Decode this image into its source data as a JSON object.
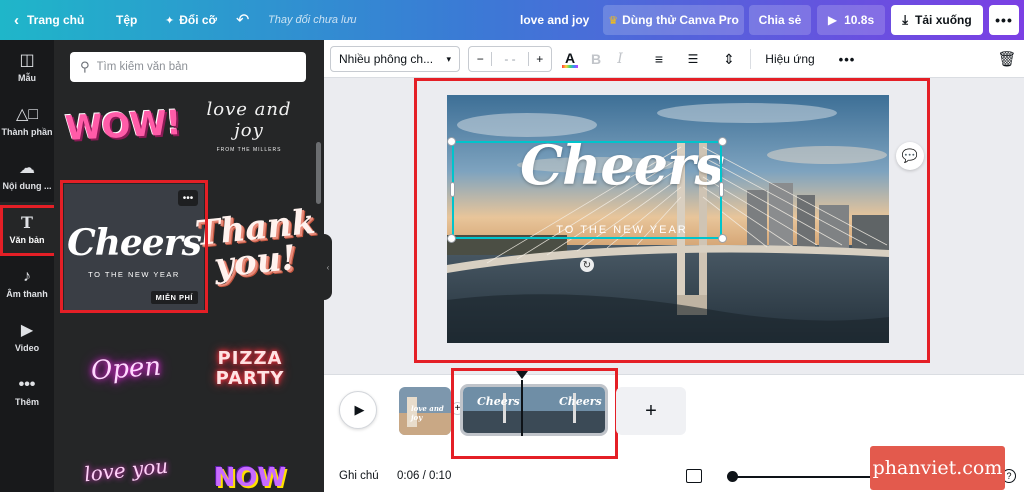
{
  "topbar": {
    "home": "Trang chủ",
    "file": "Tệp",
    "resize": "Đổi cỡ",
    "unsaved": "Thay đổi chưa lưu",
    "title": "love and joy",
    "try_pro": "Dùng thử Canva Pro",
    "share": "Chia sẻ",
    "duration": "10.8s",
    "download": "Tải xuống"
  },
  "rail": {
    "items": [
      {
        "label": "Mẫu",
        "icon": "template-icon"
      },
      {
        "label": "Thành phần",
        "icon": "elements-icon"
      },
      {
        "label": "Nội dung ...",
        "icon": "upload-icon"
      },
      {
        "label": "Văn bản",
        "icon": "text-icon"
      },
      {
        "label": "Âm thanh",
        "icon": "audio-icon"
      },
      {
        "label": "Video",
        "icon": "video-icon"
      },
      {
        "label": "Thêm",
        "icon": "more-icon"
      }
    ]
  },
  "panel": {
    "search_placeholder": "Tìm kiếm văn bản",
    "tiles": {
      "wow": "WOW!",
      "love_joy": "love and joy",
      "love_joy_sub": "FROM THE MILLERS",
      "cheers": "Cheers",
      "cheers_sub": "TO THE NEW YEAR",
      "free_badge": "MIỄN PHÍ",
      "thank_you_1": "Thank",
      "thank_you_2": "you!",
      "open": "Open",
      "pizza": "PIZZA",
      "party": "PARTY",
      "love2": "love you",
      "now": "NOW"
    }
  },
  "toolbar": {
    "font": "Nhiều phông ch...",
    "size": "- -",
    "effects": "Hiệu ứng"
  },
  "canvas": {
    "headline": "Cheers",
    "subline": "TO THE NEW YEAR"
  },
  "timeline": {
    "notes": "Ghi chú",
    "time": "0:06 / 0:10",
    "thumb1_text": "love and joy",
    "thumb2_text": "Cheers",
    "thumb3_text": "Cheers"
  },
  "watermark": "phanviet.com",
  "colors": {
    "accent_red": "#e41f26",
    "selection": "#00c4cc",
    "pro_crown": "#ffc107"
  }
}
